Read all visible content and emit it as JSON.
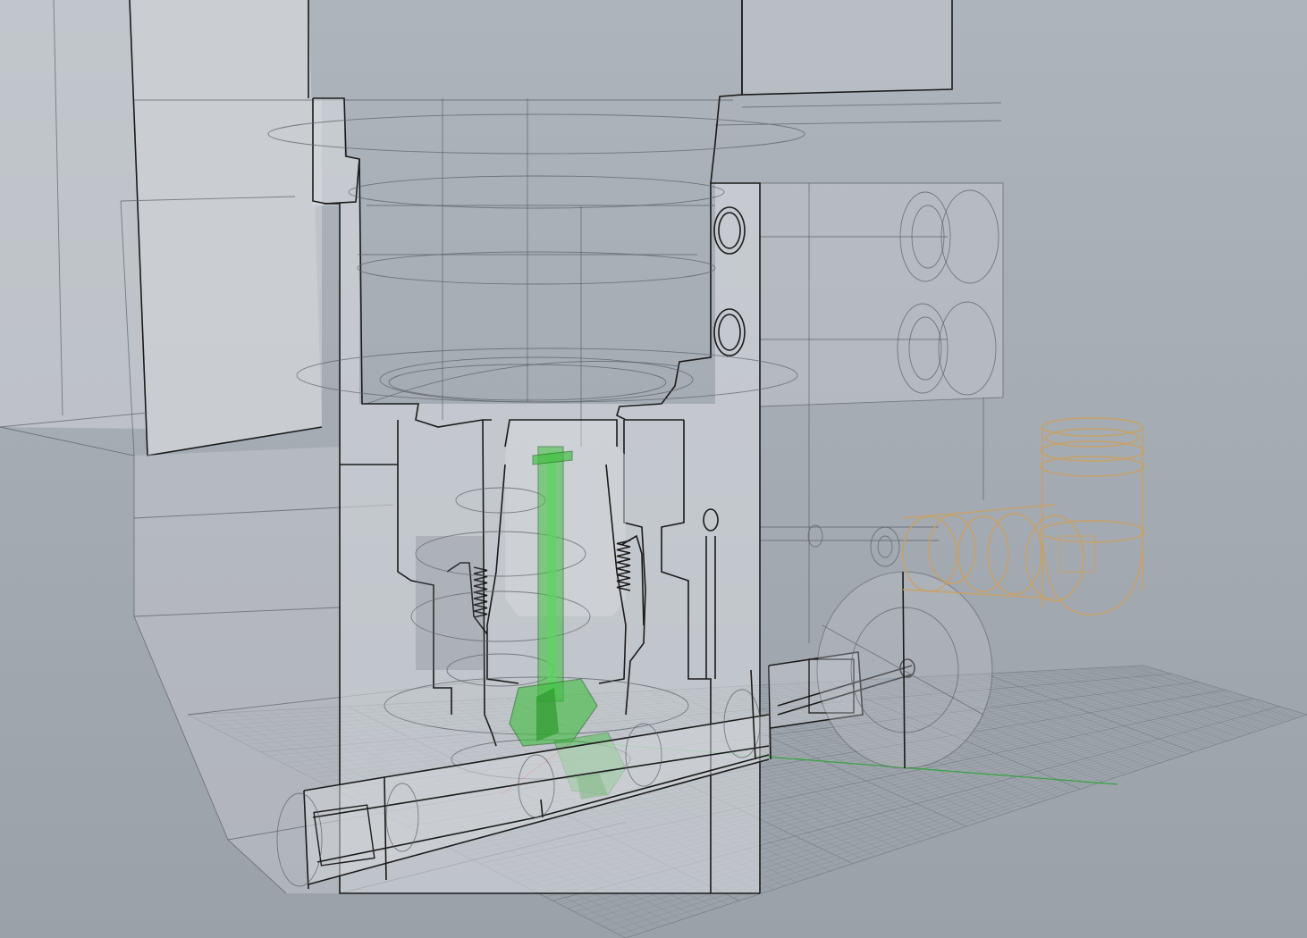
{
  "viewport": {
    "background": "#a8aeb6",
    "section_fill": "#d8dbdf",
    "part_colors": {
      "valve_stem": "#3fbf3f",
      "fitting_elbow": "#c9a064",
      "axis_x": "#c04040",
      "axis_y": "#2fa63c"
    }
  }
}
